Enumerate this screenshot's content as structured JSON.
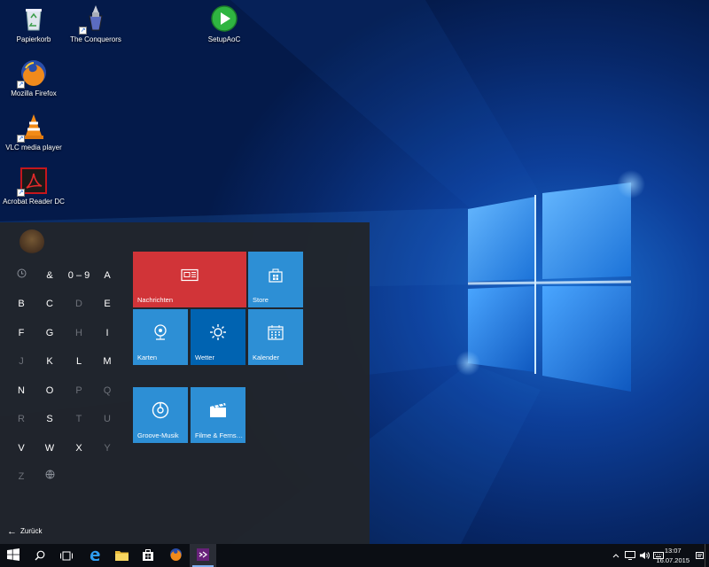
{
  "desktop": {
    "icons": [
      {
        "label": "Papierkorb",
        "icon": "recycle-bin-icon"
      },
      {
        "label": "The Conquerors",
        "icon": "age-of-empires-icon"
      },
      {
        "label": "SetupAoC",
        "icon": "setup-play-icon"
      },
      {
        "label": "Mozilla Firefox",
        "icon": "firefox-icon"
      },
      {
        "label": "VLC media player",
        "icon": "vlc-icon"
      },
      {
        "label": "Acrobat Reader DC",
        "icon": "acrobat-icon"
      }
    ]
  },
  "start_menu": {
    "letters": [
      "&",
      "0 – 9",
      "A",
      "B",
      "C",
      "D",
      "E",
      "F",
      "G",
      "H",
      "I",
      "J",
      "K",
      "L",
      "M",
      "N",
      "O",
      "P",
      "Q",
      "R",
      "S",
      "T",
      "U",
      "V",
      "W",
      "X",
      "Y",
      "Z"
    ],
    "back_label": "Zurück",
    "tiles": [
      {
        "label": "Nachrichten",
        "color": "#d13438",
        "icon": "news-icon"
      },
      {
        "label": "Store",
        "color": "#2d8fd5",
        "icon": "store-bag-icon"
      },
      {
        "label": "Karten",
        "color": "#2d8fd5",
        "icon": "maps-icon"
      },
      {
        "label": "Wetter",
        "color": "#0063b1",
        "icon": "weather-sun-icon"
      },
      {
        "label": "Kalender",
        "color": "#2d8fd5",
        "icon": "calendar-icon"
      },
      {
        "label": "Groove-Musik",
        "color": "#2d8fd5",
        "icon": "groove-music-icon"
      },
      {
        "label": "Filme & Ferns…",
        "color": "#2d8fd5",
        "icon": "movies-tv-icon"
      }
    ]
  },
  "taskbar": {
    "pinned": [
      "start-windows-icon",
      "search-icon",
      "task-view-icon",
      "edge-icon",
      "file-explorer-icon",
      "store-icon",
      "firefox-icon",
      "visual-studio-icon"
    ],
    "clock_time": "13:07",
    "clock_date": "16.07.2015"
  },
  "colors": {
    "accent": "#0078d7",
    "tile_blue": "#2d8fd5",
    "tile_red": "#d13438",
    "tile_darkblue": "#0063b1"
  }
}
